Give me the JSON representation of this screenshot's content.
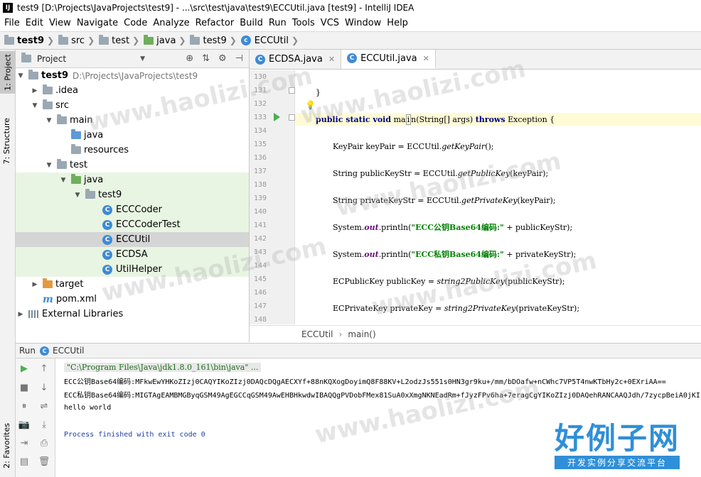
{
  "window": {
    "logo": "IJ",
    "title": "test9 [D:\\Projects\\JavaProjects\\test9] - ...\\src\\test\\java\\test9\\ECCUtil.java [test9] - IntelliJ IDEA"
  },
  "menu": [
    {
      "label": "File"
    },
    {
      "label": "Edit"
    },
    {
      "label": "View"
    },
    {
      "label": "Navigate"
    },
    {
      "label": "Code"
    },
    {
      "label": "Analyze"
    },
    {
      "label": "Refactor"
    },
    {
      "label": "Build"
    },
    {
      "label": "Run"
    },
    {
      "label": "Tools"
    },
    {
      "label": "VCS"
    },
    {
      "label": "Window"
    },
    {
      "label": "Help"
    }
  ],
  "breadcrumb": [
    "test9",
    "src",
    "test",
    "java",
    "test9",
    "ECCUtil"
  ],
  "left_strip": {
    "project_tab": "1: Project",
    "structure_tab": "7: Structure",
    "favorites_tab": "2: Favorites"
  },
  "project_panel": {
    "title": "Project",
    "tree": [
      {
        "label": "test9",
        "detail": "D:\\Projects\\JavaProjects\\test9",
        "icon": "folder-icon"
      },
      {
        "label": ".idea",
        "icon": "folder-icon"
      },
      {
        "label": "src",
        "icon": "folder-icon"
      },
      {
        "label": "main",
        "icon": "folder-icon"
      },
      {
        "label": "java",
        "icon": "source-folder-icon"
      },
      {
        "label": "resources",
        "icon": "resources-folder-icon"
      },
      {
        "label": "test",
        "icon": "folder-icon"
      },
      {
        "label": "java",
        "icon": "test-source-folder-icon"
      },
      {
        "label": "test9",
        "icon": "package-icon"
      },
      {
        "label": "ECCCoder",
        "icon": "class-icon"
      },
      {
        "label": "ECCCoderTest",
        "icon": "class-icon"
      },
      {
        "label": "ECCUtil",
        "icon": "class-icon"
      },
      {
        "label": "ECDSA",
        "icon": "class-icon"
      },
      {
        "label": "UtilHelper",
        "icon": "class-icon"
      },
      {
        "label": "target",
        "icon": "folder-icon"
      },
      {
        "label": "pom.xml",
        "icon": "maven-icon"
      },
      {
        "label": "External Libraries",
        "icon": "library-icon"
      }
    ]
  },
  "editor": {
    "tabs": [
      {
        "label": "ECDSA.java",
        "active": false
      },
      {
        "label": "ECCUtil.java",
        "active": true
      }
    ],
    "line_numbers": [
      "130",
      "131",
      "132",
      "133",
      "134",
      "135",
      "136",
      "137",
      "138",
      "139",
      "140",
      "141",
      "142",
      "143",
      "144",
      "145",
      "146",
      "147",
      "148"
    ],
    "code": {
      "l131": "}",
      "l133_kw": "public static void",
      "l133_name_a": "ma",
      "l133_name_b": "i",
      "l133_name_c": "n",
      "l133_params": "(String[] args) ",
      "l133_throws": "throws",
      "l133_rest": " Exception {",
      "l135_a": "KeyPair keyPair = ECCUtil.",
      "l135_m": "getKeyPair",
      "l135_b": "();",
      "l137_a": "String publicKeyStr = ECCUtil.",
      "l137_m": "getPublicKey",
      "l137_b": "(keyPair);",
      "l139_a": "String privateKeyStr = ECCUtil.",
      "l139_m": "getPrivateKey",
      "l139_b": "(keyPair);",
      "l141_a": "System.",
      "l141_out": "out",
      "l141_b": ".println(",
      "l141_str": "\"ECC公钥Base64编码:\"",
      "l141_c": " + publicKeyStr);",
      "l143_a": "System.",
      "l143_out": "out",
      "l143_b": ".println(",
      "l143_str": "\"ECC私钥Base64编码:\"",
      "l143_c": " + privateKeyStr);",
      "l145_a": "ECPublicKey publicKey = ",
      "l145_m": "string2PublicKey",
      "l145_b": "(publicKeyStr);",
      "l147_a": "ECPrivateKey privateKey = ",
      "l147_m": "string2PrivateKey",
      "l147_b": "(privateKeyStr);"
    },
    "breadcrumb": [
      "ECCUtil",
      "main()"
    ]
  },
  "run_panel": {
    "label": "Run",
    "config": "ECCUtil",
    "console": [
      "\"C:\\Program Files\\Java\\jdk1.8.0_161\\bin\\java\" ...",
      "ECC公钥Base64编码:MFkwEwYHKoZIzj0CAQYIKoZIzj0DAQcDQgAECXYf+88nKQXogDoyimQ8F88KV+L2odzJs551s0HN3gr9ku+/mm/bDOafw+nCWhc7VP5T4nwKTbHy2c+0EXriAA==",
      "ECC私钥Base64编码:MIGTAgEAMBMGByqGSM49AgEGCCqGSM49AwEHBHkwdwIBAQQgPVDobFMex81SuA0xXmgNKNEadRm+fJyzFPv6ha+7eragCgYIKoZIzj0DAQehRANCAAQJdh/7zycpBeiA0jKI",
      "hello world",
      "Process finished with exit code 0"
    ]
  },
  "watermark": {
    "text": "www.haolizi.com",
    "logo_text": "好例子网",
    "logo_sub": "开发实例分享交流平台",
    "color": "#2f8fd8"
  }
}
